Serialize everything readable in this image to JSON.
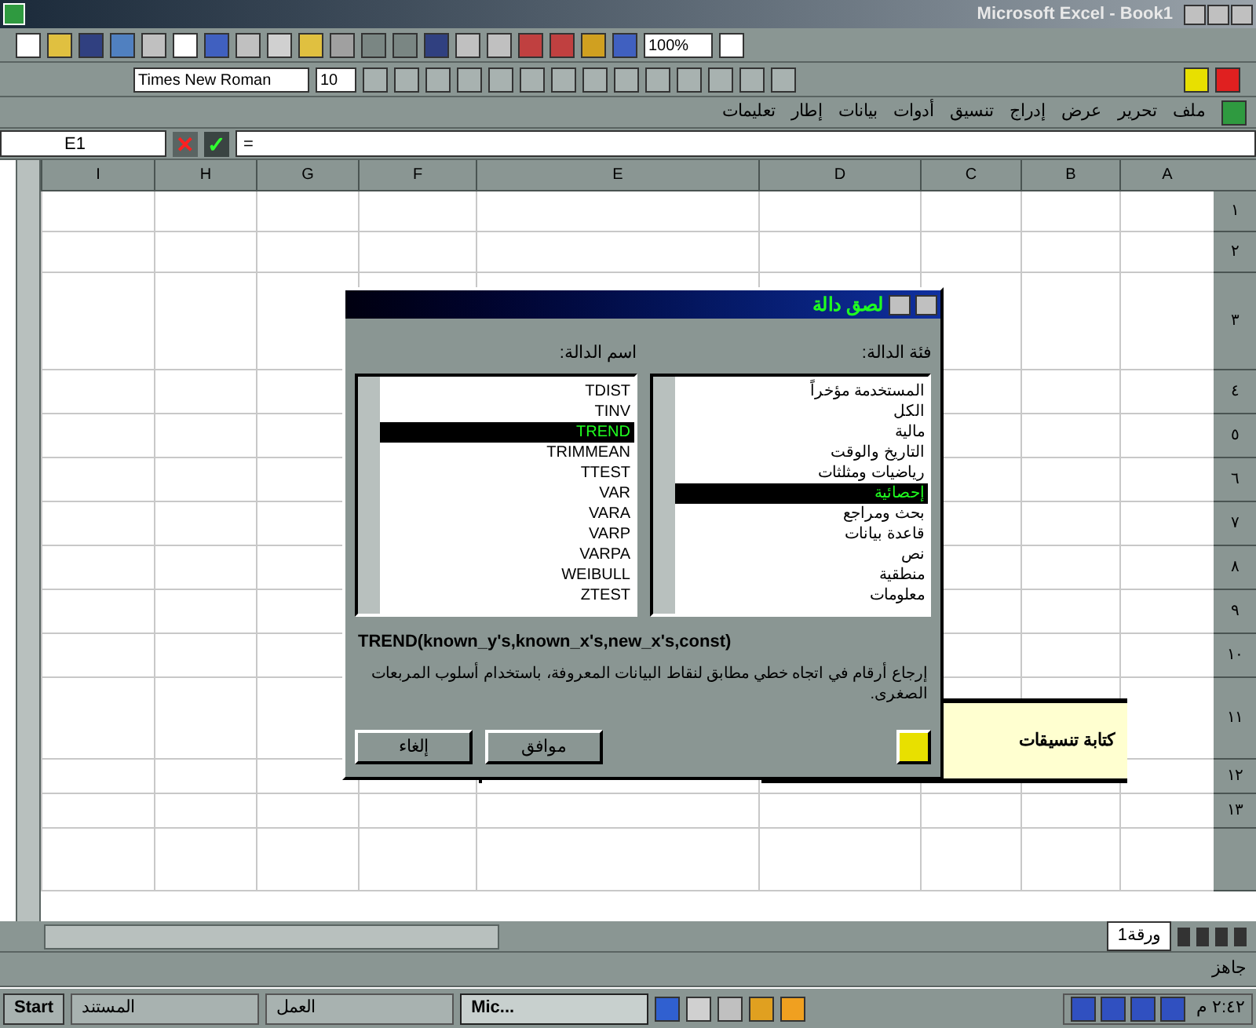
{
  "window": {
    "title": "Microsoft Excel - Book1"
  },
  "formatting": {
    "font": "Times New Roman",
    "size": "10",
    "zoom": "100%"
  },
  "menu_bar": [
    "ملف",
    "تحرير",
    "عرض",
    "إدراج",
    "تنسيق",
    "أدوات",
    "بيانات",
    "إطار",
    "تعليمات"
  ],
  "formula_buttons": [
    "✓",
    "✕"
  ],
  "formula_bar": {
    "name_box": "E1",
    "formula": "="
  },
  "sheet": {
    "columns": [
      "A",
      "B",
      "C",
      "D",
      "E",
      "F",
      "G",
      "H",
      "I"
    ],
    "rows": [
      "١",
      "٢",
      "٣",
      "٤",
      "٥",
      "٦",
      "٧",
      "٨",
      "٩",
      "١٠",
      "١١",
      "١٢",
      "١٣"
    ],
    "callout": "كتابة تنسيقات"
  },
  "dialog": {
    "title": "لصق دالة",
    "category_label": "فئة الدالة:",
    "function_label": "اسم الدالة:",
    "categories": [
      {
        "label": "المستخدمة مؤخراً",
        "selected": false
      },
      {
        "label": "الكل",
        "selected": false
      },
      {
        "label": "مالية",
        "selected": false
      },
      {
        "label": "التاريخ والوقت",
        "selected": false
      },
      {
        "label": "رياضيات ومثلثات",
        "selected": false
      },
      {
        "label": "إحصائية",
        "selected": true
      },
      {
        "label": "بحث ومراجع",
        "selected": false
      },
      {
        "label": "قاعدة بيانات",
        "selected": false
      },
      {
        "label": "نص",
        "selected": false
      },
      {
        "label": "منطقية",
        "selected": false
      },
      {
        "label": "معلومات",
        "selected": false
      }
    ],
    "functions": [
      {
        "label": "TDIST",
        "selected": false
      },
      {
        "label": "TINV",
        "selected": false
      },
      {
        "label": "TREND",
        "selected": true
      },
      {
        "label": "TRIMMEAN",
        "selected": false
      },
      {
        "label": "TTEST",
        "selected": false
      },
      {
        "label": "VAR",
        "selected": false
      },
      {
        "label": "VARA",
        "selected": false
      },
      {
        "label": "VARP",
        "selected": false
      },
      {
        "label": "VARPA",
        "selected": false
      },
      {
        "label": "WEIBULL",
        "selected": false
      },
      {
        "label": "ZTEST",
        "selected": false
      }
    ],
    "syntax": "TREND(known_y's,known_x's,new_x's,const)",
    "description": "إرجاع أرقام في اتجاه خطي مطابق لنقاط البيانات المعروفة، باستخدام أسلوب المربعات الصغرى.",
    "buttons": [
      "موافق",
      "إلغاء"
    ]
  },
  "sheet_tab": "ورقة1",
  "status": "جاهز",
  "taskbar": {
    "start": "Start",
    "tasks": [
      {
        "label": "Mic...",
        "selected": true
      },
      {
        "label": "العمل",
        "selected": false
      },
      {
        "label": "المستند",
        "selected": false
      }
    ],
    "clock": "٢:٤٢ م"
  }
}
